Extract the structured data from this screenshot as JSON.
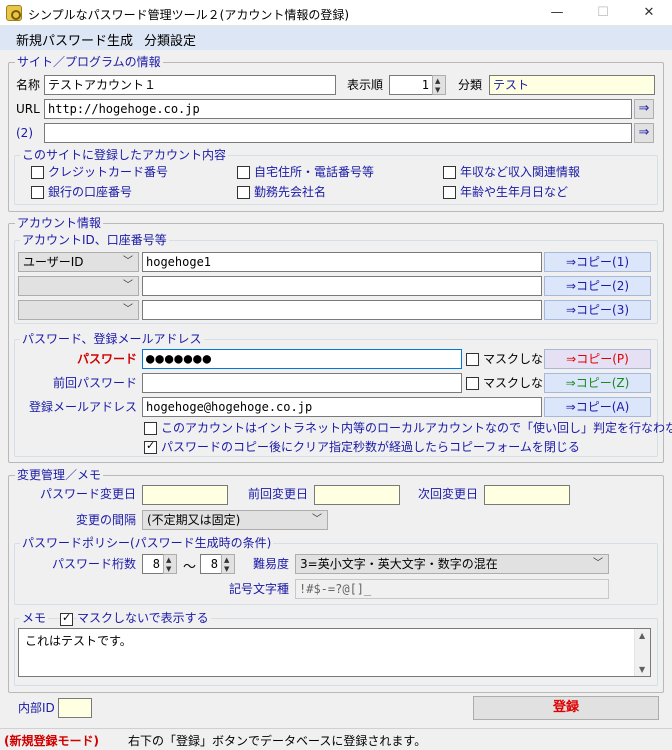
{
  "window": {
    "title": "シンプルなパスワード管理ツール２(アカウント情報の登録)",
    "minimize": "—",
    "maximize": "☐",
    "close": "✕"
  },
  "menu": [
    "新規パスワード生成",
    "分類設定"
  ],
  "site": {
    "legend": "サイト／プログラムの情報",
    "name_label": "名称",
    "name_value": "テストアカウント１",
    "order_label": "表示順",
    "order_value": "1",
    "category_label": "分類",
    "category_value": "テスト",
    "url_label": "URL",
    "url_value": "http://hogehoge.co.jp",
    "url2_label": "(2)",
    "url2_value": "",
    "go_arrow": "⇒"
  },
  "account_content": {
    "legend": "このサイトに登録したアカウント内容",
    "items": [
      {
        "label": "クレジットカード番号",
        "checked": false
      },
      {
        "label": "自宅住所・電話番号等",
        "checked": false
      },
      {
        "label": "年収など収入関連情報",
        "checked": false
      },
      {
        "label": "銀行の口座番号",
        "checked": false
      },
      {
        "label": "勤務先会社名",
        "checked": false
      },
      {
        "label": "年齢や生年月日など",
        "checked": false
      }
    ]
  },
  "account_info": {
    "legend": "アカウント情報",
    "id_legend": "アカウントID、口座番号等",
    "rows": [
      {
        "type": "ユーザーID",
        "value": "hogehoge1",
        "copy": "⇒コピー(1)"
      },
      {
        "type": "",
        "value": "",
        "copy": "⇒コピー(2)"
      },
      {
        "type": "",
        "value": "",
        "copy": "⇒コピー(3)"
      }
    ],
    "pw_legend": "パスワード、登録メールアドレス",
    "password_label": "パスワード",
    "password_value": "●●●●●●●",
    "mask_label": "マスクしない",
    "copy_p": "⇒コピー(P)",
    "prev_password_label": "前回パスワード",
    "prev_password_value": "",
    "copy_z": "⇒コピー(Z)",
    "email_label": "登録メールアドレス",
    "email_value": "hogehoge@hogehoge.co.jp",
    "copy_a": "⇒コピー(A)",
    "opt1": "このアカウントはイントラネット内等のローカルアカウントなので「使い回し」判定を行なわない",
    "opt2": "パスワードのコピー後にクリア指定秒数が経過したらコピーフォームを閉じる"
  },
  "change": {
    "legend": "変更管理／メモ",
    "pw_changed_label": "パスワード変更日",
    "pw_changed_value": "",
    "prev_changed_label": "前回変更日",
    "prev_changed_value": "",
    "next_changed_label": "次回変更日",
    "next_changed_value": "",
    "interval_label": "変更の間隔",
    "interval_value": "(不定期又は固定)"
  },
  "policy": {
    "legend": "パスワードポリシー(パスワード生成時の条件)",
    "digits_label": "パスワード桁数",
    "min": "8",
    "tilde": "～",
    "max": "8",
    "difficulty_label": "難易度",
    "difficulty_value": "3=英小文字・英大文字・数字の混在",
    "symbols_label": "記号文字種",
    "symbols_value": "!#$-=?@[]_"
  },
  "memo": {
    "legend": "メモ",
    "show_label": "マスクしないで表示する",
    "text": "これはテストです。"
  },
  "footer": {
    "internal_id_label": "内部ID",
    "internal_id_value": "",
    "register_label": "登録",
    "mode": "(新規登録モード)",
    "status": "右下の「登録」ボタンでデータベースに登録されます。"
  }
}
